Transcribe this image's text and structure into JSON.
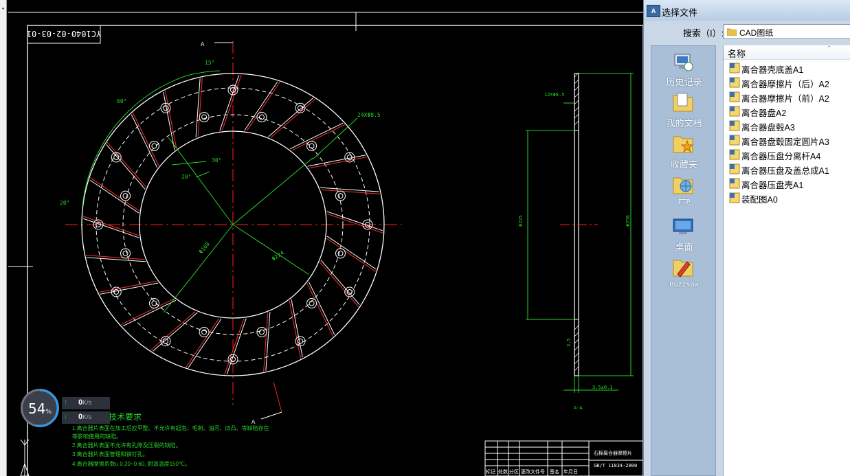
{
  "drawing": {
    "part_code": "YC1040-02-03-01",
    "tech_title": "技术要求",
    "notes": [
      "1.离合器片表面在加工后应平整。不允许有起泡、毛刺、油污、凹凸、等缺陷存在",
      "    等影响使用的缺陷。",
      "2.离合器片表面不允许有孔隙及压裂的缺陷。",
      "3.离合器片表面管理和铆钉孔。",
      "4.离合器摩擦系数u 0.20~0.60, 耐温温度150℃。"
    ],
    "dims": {
      "d1": "15°",
      "d2": "60°",
      "d3": "24XΦ8.5",
      "d4": "30°",
      "d5": "20°",
      "d6": "20°",
      "d7": "Φ160",
      "d8": "Φ224",
      "d9": "12XΦ8.5",
      "d10": "Φ225",
      "d11": "Φ250",
      "d12": "3.5",
      "d13": "3.5±0.1",
      "section_label": "A-A",
      "section_mark": "A"
    },
    "title_block": {
      "name": "石棉离合器摩擦片",
      "standard": "GB/T 11834-2000",
      "headers": [
        "标记",
        "处数",
        "分区",
        "更改文件号",
        "签名",
        "年月日"
      ]
    }
  },
  "monitor": {
    "percent": "54",
    "percent_value": 0.54,
    "percent_unit": "%",
    "upload": "0",
    "download": "0",
    "unit": "K/s",
    "ring_color": "#2f9be8"
  },
  "dialog": {
    "title": "选择文件",
    "search_label": "搜索（I）:",
    "search_value": "CAD图纸",
    "places": [
      {
        "label": "历史记录",
        "icon": "history-icon"
      },
      {
        "label": "我的文档",
        "icon": "documents-folder-icon"
      },
      {
        "label": "收藏夹",
        "icon": "favorites-folder-icon"
      },
      {
        "label": "FTP",
        "icon": "ftp-icon"
      },
      {
        "label": "桌面",
        "icon": "desktop-icon"
      },
      {
        "label": "Buzzsaw",
        "icon": "buzzsaw-icon"
      }
    ],
    "column_name": "名称",
    "files": [
      {
        "name": "离合器壳底盖A1",
        "type": "dwg"
      },
      {
        "name": "离合器摩擦片（后）A2",
        "type": "dwg"
      },
      {
        "name": "离合器摩擦片（前）A2",
        "type": "dwg"
      },
      {
        "name": "离合器盘A2",
        "type": "dwg"
      },
      {
        "name": "离合器盘毂A3",
        "type": "dwg"
      },
      {
        "name": "离合器盘毂固定圆片A3",
        "type": "dwg"
      },
      {
        "name": "离合器压盘分离杆A4",
        "type": "dwg"
      },
      {
        "name": "离合器压盘及盖总成A1",
        "type": "dwg"
      },
      {
        "name": "离合器压盘壳A1",
        "type": "dwg"
      },
      {
        "name": "装配图A0",
        "type": "dwg"
      }
    ]
  }
}
